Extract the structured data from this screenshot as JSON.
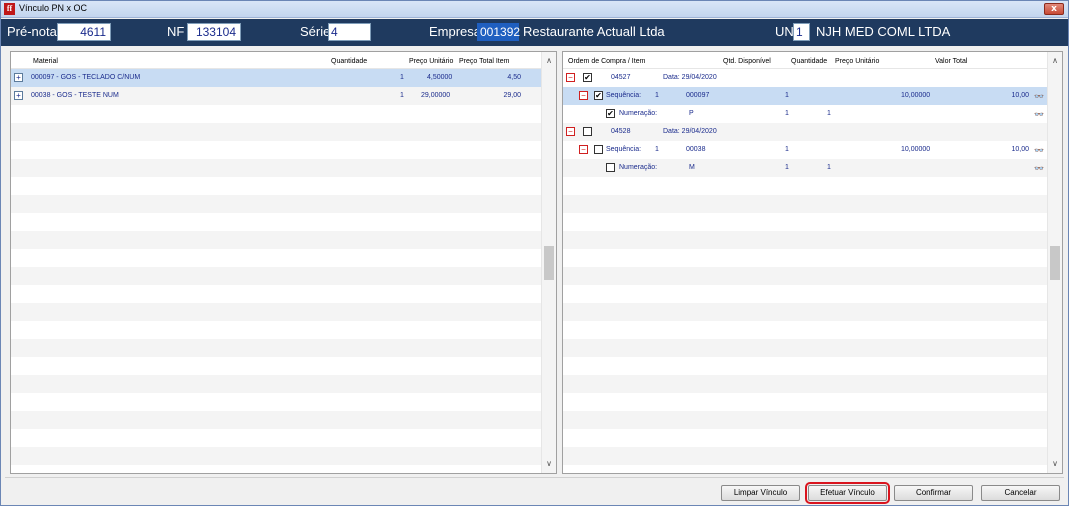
{
  "window": {
    "title": "Vínculo PN x OC",
    "app_icon_glyph": "ff",
    "close_glyph": "x"
  },
  "header": {
    "prenota_label": "Pré-nota",
    "prenota_value": "4611",
    "nf_label": "NF",
    "nf_value": "133104",
    "serie_label": "Série",
    "serie_value": "4",
    "empresa_label": "Empresa",
    "empresa_code": "001392",
    "empresa_name": "Restaurante Actuall Ltda",
    "un_label": "UN",
    "un_value": "1",
    "un_name": "NJH MED COML LTDA"
  },
  "left_panel": {
    "columns": {
      "material": "Material",
      "quantidade": "Quantidade",
      "preco_unitario": "Preço Unitário",
      "preco_total": "Preço Total Item"
    },
    "rows": [
      {
        "material": "000097 - GOS - TECLADO C/NUM",
        "quantidade": "1",
        "preco_unitario": "4,50000",
        "preco_total": "4,50"
      },
      {
        "material": "00038 - GOS - TESTE NUM",
        "quantidade": "1",
        "preco_unitario": "29,00000",
        "preco_total": "29,00"
      }
    ]
  },
  "right_panel": {
    "columns": {
      "ordem": "Ordem de Compra / Item",
      "qtd_disponivel": "Qtd. Disponível",
      "quantidade": "Quantidade",
      "preco_unitario": "Preço Unitário",
      "valor_total": "Valor Total"
    },
    "orders": [
      {
        "number": "04527",
        "date_label": "Data: 29/04/2020",
        "checked": true,
        "seq_label": "Sequência:",
        "seq_num": "1",
        "item_code": "000097",
        "qtd": "1",
        "preco": "10,00000",
        "valor": "10,00",
        "seq_checked": true,
        "num_label": "Numeração:",
        "num_value": "P",
        "num_qtd": "1",
        "num_quant": "1",
        "num_checked": true
      },
      {
        "number": "04528",
        "date_label": "Data: 29/04/2020",
        "checked": false,
        "seq_label": "Sequência:",
        "seq_num": "1",
        "item_code": "00038",
        "qtd": "1",
        "preco": "10,00000",
        "valor": "10,00",
        "seq_checked": false,
        "num_label": "Numeração:",
        "num_value": "M",
        "num_qtd": "1",
        "num_quant": "1",
        "num_checked": false
      }
    ],
    "check_glyph": "✔",
    "glasses_glyph": "👓"
  },
  "buttons": {
    "limpar": "Limpar Vínculo",
    "efetuar": "Efetuar Vínculo",
    "confirmar": "Confirmar",
    "cancelar": "Cancelar"
  },
  "icons": {
    "expand": "+",
    "collapse": "−",
    "scroll_up": "∧",
    "scroll_down": "∨"
  },
  "colors": {
    "header_bg": "#1f3a5f",
    "selected_row": "#c8dcf3",
    "text_blue": "#1a2b8c",
    "highlight_red": "#d9141e"
  }
}
